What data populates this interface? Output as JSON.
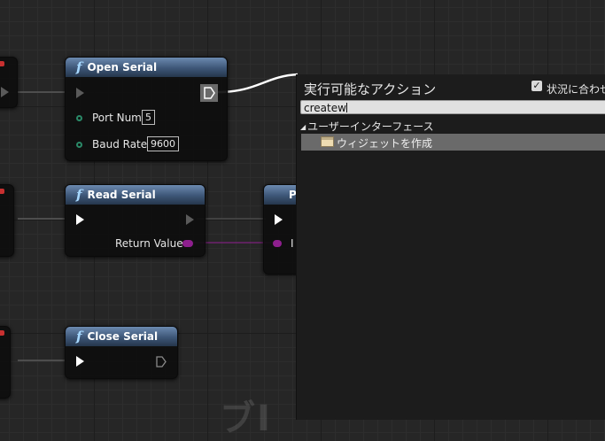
{
  "nodes": {
    "open_serial": {
      "title": "Open Serial",
      "fn_glyph": "f",
      "pins": {
        "port_label": "Port Num",
        "port_value": "5",
        "baud_label": "Baud Rate",
        "baud_value": "9600"
      }
    },
    "read_serial": {
      "title": "Read Serial",
      "fn_glyph": "f",
      "return_label": "Return Value"
    },
    "close_serial": {
      "title": "Close Serial",
      "fn_glyph": "f"
    },
    "partial_node": {
      "title_fragment": "P",
      "pin_fragment": "I"
    }
  },
  "watermark": "ブI",
  "action_menu": {
    "title": "実行可能なアクション",
    "context_checkbox_checked": true,
    "context_label": "状況に合わせ",
    "search_value": "createw",
    "category": "ユーザーインターフェース",
    "item": "ウィジェットを作成"
  },
  "colors": {
    "header_blue": "#3d5677",
    "exec_wire": "#ffffff",
    "int_pin_green": "#2a8a68",
    "string_pin_magenta": "#8e1f8e",
    "selection_gray": "#6a6a6a"
  },
  "icons": [
    "function-icon",
    "exec-pin-icon",
    "checkbox-icon",
    "widget-icon",
    "category-arrow-icon"
  ]
}
